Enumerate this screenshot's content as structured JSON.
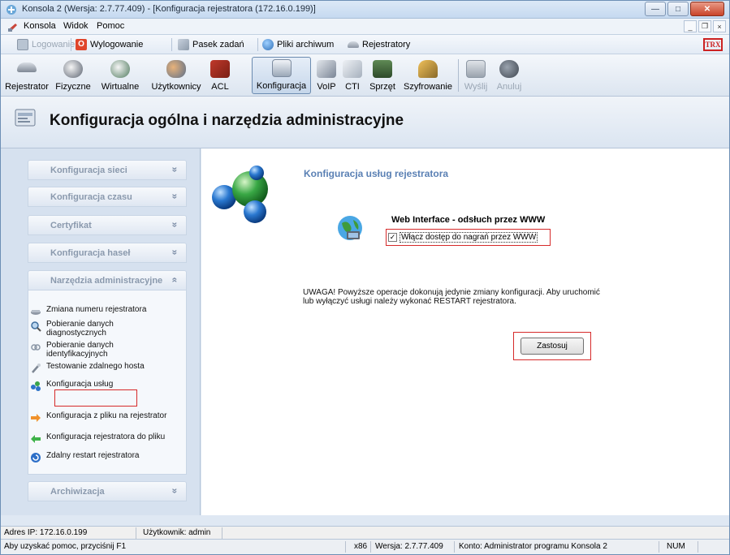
{
  "window": {
    "title": "Konsola 2 (Wersja: 2.7.77.409) - [Konfiguracja rejestratora (172.16.0.199)]",
    "controls": {
      "minimize": "—",
      "maximize": "□",
      "close": "✕"
    }
  },
  "menu": {
    "items": [
      "Konsola",
      "Widok",
      "Pomoc"
    ],
    "mdi": {
      "minimize": "_",
      "restore": "❐",
      "close": "×"
    }
  },
  "quickbar": {
    "login": "Logowanie",
    "logout": "Wylogowanie",
    "taskbar": "Pasek zadań",
    "archive": "Pliki archiwum",
    "recorders": "Rejestratory",
    "brand": "TRX"
  },
  "toolbar": {
    "buttons": [
      "Rejestrator",
      "Fizyczne",
      "Wirtualne",
      "Użytkownicy",
      "ACL",
      "Konfiguracja",
      "VoIP",
      "CTI",
      "Sprzęt",
      "Szyfrowanie",
      "Wyślij",
      "Anuluj"
    ],
    "active": "Konfiguracja"
  },
  "header": {
    "title": "Konfiguracja ogólna i narzędzia administracyjne"
  },
  "sidebar": {
    "sections": [
      "Konfiguracja sieci",
      "Konfiguracja czasu",
      "Certyfikat",
      "Konfiguracja haseł",
      "Narzędzia administracyjne",
      "Archiwizacja"
    ],
    "chev_down": "»",
    "chev_up": "«",
    "tools": [
      "Zmiana numeru rejestratora",
      "Pobieranie danych diagnostycznych",
      "Pobieranie danych identyfikacyjnych",
      "Testowanie zdalnego hosta",
      "Konfiguracja usług",
      "Konfiguracja z pliku na rejestrator",
      "Konfiguracja rejestratora do pliku",
      "Zdalny restart rejestratora"
    ],
    "selected": "Konfiguracja usług"
  },
  "main": {
    "title": "Konfiguracja usług rejestratora",
    "web_title": "Web Interface - odsłuch przez WWW",
    "checkbox_label": "Włącz dostęp do nagrań przez WWW",
    "checkbox_checked": true,
    "checkmark": "✓",
    "warning": "UWAGA! Powyższe operacje dokonują jedynie zmiany konfiguracji. Aby uruchomić lub wyłączyć usługi należy wykonać RESTART rejestratora.",
    "apply": "Zastosuj"
  },
  "status": {
    "ip": "Adres IP: 172.16.0.199",
    "user": "Użytkownik: admin",
    "help": "Aby uzyskać pomoc, przyciśnij F1",
    "arch": "x86",
    "version": "Wersja: 2.7.77.409",
    "account": "Konto: Administrator programu Konsola 2",
    "num": "NUM"
  },
  "colors": {
    "highlight": "#d62a2a",
    "accent": "#5a80b4",
    "panel": "#d6e1ef"
  }
}
